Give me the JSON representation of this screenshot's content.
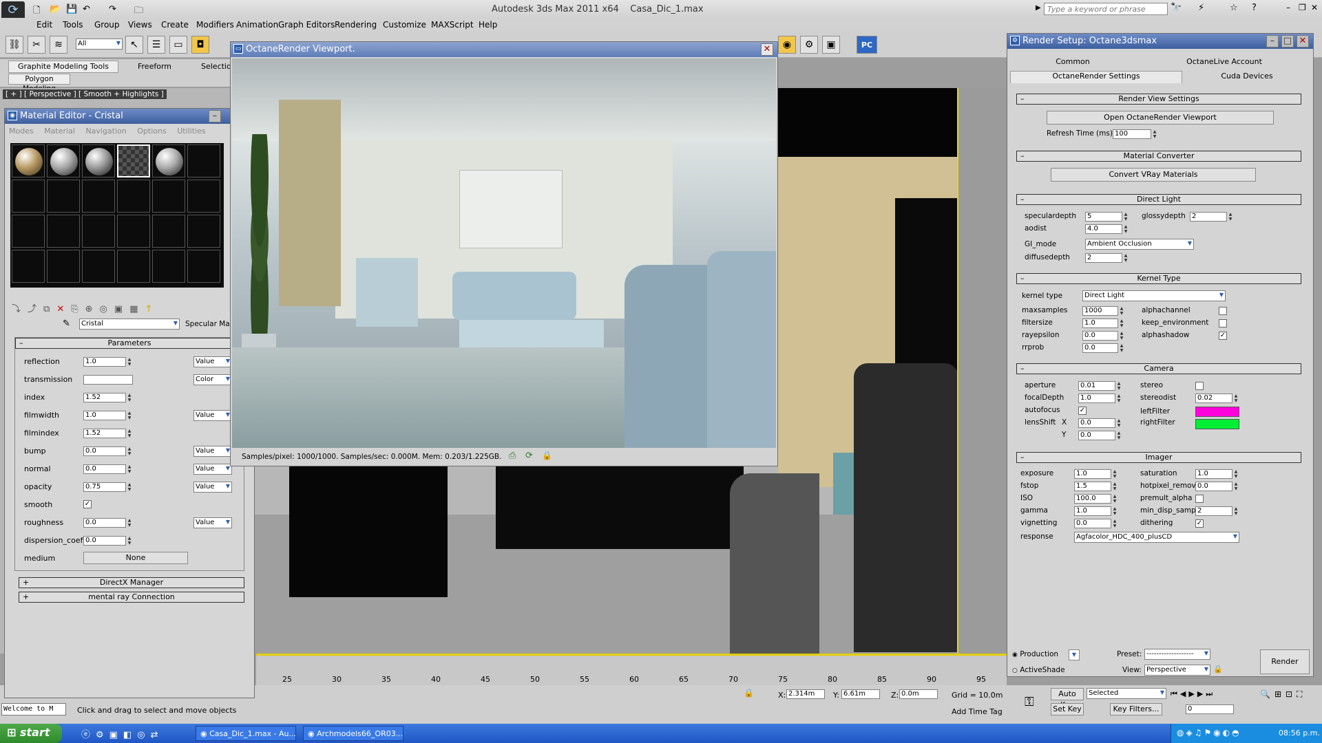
{
  "app": {
    "title": "Autodesk 3ds Max  2011 x64",
    "file": "Casa_Dic_1.max",
    "search_placeholder": "Type a keyword or phrase"
  },
  "menu": [
    "Edit",
    "Tools",
    "Group",
    "Views",
    "Create",
    "Modifiers",
    "Animation",
    "Graph Editors",
    "Rendering",
    "Customize",
    "MAXScript",
    "Help"
  ],
  "toolbar": {
    "selection_filter": "All",
    "pc_label": "PC"
  },
  "ribbon": {
    "tabs": [
      "Graphite Modeling Tools",
      "Freeform",
      "Selection"
    ],
    "sub": "Polygon Modeling",
    "viewport_label": "[ + ] [ Perspective ] [ Smooth + Highlights ]"
  },
  "material_editor": {
    "title": "Material Editor - Cristal",
    "menu": [
      "Modes",
      "Material",
      "Navigation",
      "Options",
      "Utilities"
    ],
    "material_name": "Cristal",
    "material_type": "Specular Mat",
    "params_title": "Parameters",
    "rows": [
      {
        "label": "reflection",
        "value": "1.0",
        "mode": "Value"
      },
      {
        "label": "transmission",
        "value": "",
        "mode": "Color"
      },
      {
        "label": "index",
        "value": "1.52",
        "mode": ""
      },
      {
        "label": "filmwidth",
        "value": "1.0",
        "mode": "Value"
      },
      {
        "label": "filmindex",
        "value": "1.52",
        "mode": ""
      },
      {
        "label": "bump",
        "value": "0.0",
        "mode": "Value"
      },
      {
        "label": "normal",
        "value": "0.0",
        "mode": "Value"
      },
      {
        "label": "opacity",
        "value": "0.75",
        "mode": "Value"
      }
    ],
    "smooth_label": "smooth",
    "smooth_checked": "✓",
    "roughness": {
      "label": "roughness",
      "value": "0.0",
      "mode": "Value"
    },
    "dispersion": {
      "label": "dispersion_coeffic",
      "value": "0.0"
    },
    "medium": {
      "label": "medium",
      "value": "None"
    },
    "rollouts": [
      "DirectX Manager",
      "mental ray Connection"
    ]
  },
  "octane_viewport": {
    "title": "OctaneRender Viewport.",
    "status": "Samples/pixel: 1000/1000. Samples/sec: 0.000M. Mem: 0.203/1.225GB."
  },
  "render_setup": {
    "title": "Render Setup: Octane3dsmax",
    "tabs": [
      "Common",
      "OctaneLive Account",
      "OctaneRender Settings",
      "Cuda Devices"
    ],
    "render_view": {
      "title": "Render View Settings",
      "button": "Open OctaneRender Viewport",
      "refresh_label": "Refresh Time (ms)",
      "refresh_value": "100"
    },
    "material_converter": {
      "title": "Material Converter",
      "button": "Convert VRay Materials"
    },
    "direct_light": {
      "title": "Direct Light",
      "specdepth_l": "speculardepth",
      "specdepth_v": "5",
      "glossy_l": "glossydepth",
      "glossy_v": "2",
      "aodist_l": "aodist",
      "aodist_v": "4.0",
      "gimode_l": "GI_mode",
      "gimode_v": "Ambient Occlusion",
      "diffuse_l": "diffusedepth",
      "diffuse_v": "2"
    },
    "kernel": {
      "title": "Kernel Type",
      "type_l": "kernel type",
      "type_v": "Direct Light",
      "maxs_l": "maxsamples",
      "maxs_v": "1000",
      "filt_l": "filtersize",
      "filt_v": "1.0",
      "ray_l": "rayepsilon",
      "ray_v": "0.0",
      "rr_l": "rrprob",
      "rr_v": "0.0",
      "alpha_l": "alphachannel",
      "keep_l": "keep_environment",
      "ashadow_l": "alphashadow",
      "ashadow_c": "✓"
    },
    "camera": {
      "title": "Camera",
      "ap_l": "aperture",
      "ap_v": "0.01",
      "fd_l": "focalDepth",
      "fd_v": "1.0",
      "af_l": "autofocus",
      "af_c": "✓",
      "ls_l": "lensShift",
      "x_l": "X",
      "x_v": "0.0",
      "y_l": "Y",
      "y_v": "0.0",
      "stereo_l": "stereo",
      "sd_l": "stereodist",
      "sd_v": "0.02",
      "lf_l": "leftFilter",
      "lf_color": "#ff00dd",
      "rf_l": "rightFilter",
      "rf_color": "#00ee33"
    },
    "imager": {
      "title": "Imager",
      "exp_l": "exposure",
      "exp_v": "1.0",
      "fs_l": "fstop",
      "fs_v": "1.5",
      "iso_l": "ISO",
      "iso_v": "100.0",
      "gm_l": "gamma",
      "gm_v": "1.0",
      "vg_l": "vignetting",
      "vg_v": "0.0",
      "sat_l": "saturation",
      "sat_v": "1.0",
      "hp_l": "hotpixel_remov",
      "hp_v": "0.0",
      "pa_l": "premult_alpha",
      "md_l": "min_disp_samp.",
      "md_v": "2",
      "di_l": "dithering",
      "di_c": "✓",
      "resp_l": "response",
      "resp_v": "Agfacolor_HDC_400_plusCD"
    },
    "footer": {
      "production": "Production",
      "activeshade": "ActiveShade",
      "preset_l": "Preset:",
      "preset_v": "-------------------",
      "view_l": "View:",
      "view_v": "Perspective",
      "render": "Render"
    }
  },
  "timeline": {
    "ticks": [
      "25",
      "30",
      "35",
      "40",
      "45",
      "50",
      "55",
      "60",
      "65",
      "70",
      "75",
      "80",
      "85",
      "90",
      "95"
    ]
  },
  "status": {
    "welcome": "Welcome to M",
    "prompt": "Click and drag to select and move objects",
    "x_l": "X:",
    "x_v": "2.314m",
    "y_l": "Y:",
    "y_v": "6.61m",
    "z_l": "Z:",
    "z_v": "0.0m",
    "grid": "Grid = 10.0m",
    "time_tag": "Add Time Tag",
    "autokey": "Auto Key",
    "setkey": "Set Key",
    "selected": "Selected",
    "keyfilters": "Key Filters...",
    "frame": "0"
  },
  "taskbar": {
    "start": "start",
    "items": [
      "Casa_Dic_1.max - Au...",
      "Archmodels66_OR03..."
    ],
    "time": "08:56 p.m."
  }
}
